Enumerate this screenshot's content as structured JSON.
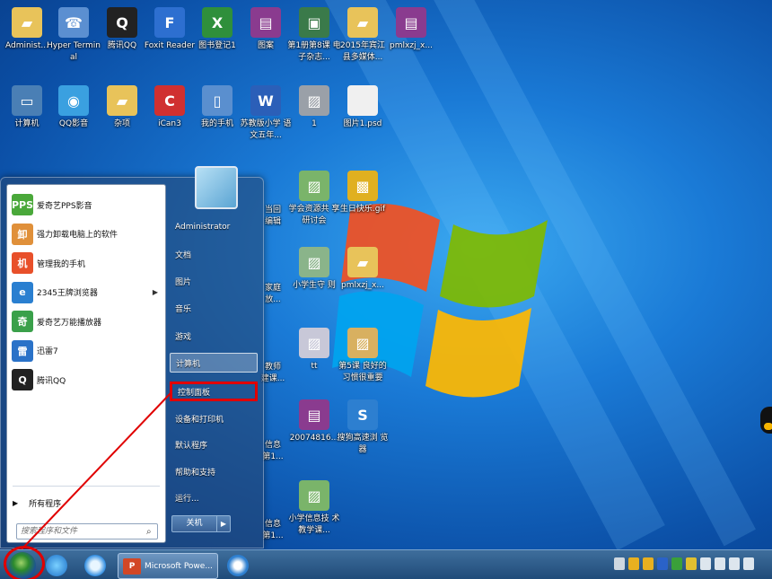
{
  "desktop": {
    "icons": [
      {
        "label": "Administ...",
        "glyph": "folder-user-icon",
        "color": "#e8c35a"
      },
      {
        "label": "Hyper Terminal",
        "glyph": "phone-network-icon",
        "color": "#5b8fd1"
      },
      {
        "label": "腾讯QQ",
        "glyph": "qq-penguin-icon",
        "color": "#222222"
      },
      {
        "label": "Foxit Reader",
        "glyph": "foxit-icon",
        "color": "#2d6fd0"
      },
      {
        "label": "图书登记1",
        "glyph": "excel-doc-icon",
        "color": "#2f8f3b"
      },
      {
        "label": "图案",
        "glyph": "winrar-icon",
        "color": "#8a3b8f"
      },
      {
        "label": "第1册第8课 电子杂志...",
        "glyph": "image-app-icon",
        "color": "#3a7a4a"
      },
      {
        "label": "2015年宾江 县多媒体...",
        "glyph": "folder-icon",
        "color": "#e8c35a"
      },
      {
        "label": "pmlxzj_x...",
        "glyph": "winrar-icon",
        "color": "#8a3b8f"
      },
      {
        "label": "计算机",
        "glyph": "computer-icon",
        "color": "#4a7fb5"
      },
      {
        "label": "QQ影音",
        "glyph": "qq-player-icon",
        "color": "#3aa0e0"
      },
      {
        "label": "杂项",
        "glyph": "folder-icon",
        "color": "#e8c35a"
      },
      {
        "label": "iCan3",
        "glyph": "ican-icon",
        "color": "#d03030"
      },
      {
        "label": "我的手机",
        "glyph": "phone-icon",
        "color": "#5a8fcf"
      },
      {
        "label": "苏教版小学 语文五年...",
        "glyph": "word-doc-icon",
        "color": "#2b5fb8"
      },
      {
        "label": "1",
        "glyph": "image-file-icon",
        "color": "#9aa0a8"
      },
      {
        "label": "图片1.psd",
        "glyph": "blank-file-icon",
        "color": "#f0f0f0"
      },
      {
        "label": "学会资源共 享研讨会",
        "glyph": "image-file-icon",
        "color": "#7ab46a"
      },
      {
        "label": "生日快乐.gif",
        "glyph": "gif-file-icon",
        "color": "#e0b020"
      },
      {
        "label": "小学生守 则",
        "glyph": "image-file-icon",
        "color": "#8ab48a"
      },
      {
        "label": "pmlxzj_x...",
        "glyph": "folder-icon",
        "color": "#e8c35a"
      },
      {
        "label": "tt",
        "glyph": "image-file-icon",
        "color": "#c8c8d8"
      },
      {
        "label": "第5课 良好的 习惯很重要",
        "glyph": "image-file-icon",
        "color": "#d8b060"
      },
      {
        "label": "20074816...",
        "glyph": "winrar-icon",
        "color": "#8a3b8f"
      },
      {
        "label": "搜狗高速浏 览器",
        "glyph": "sogou-browser-icon",
        "color": "#2d7fd0"
      },
      {
        "label": "小学信息技 术教学课...",
        "glyph": "image-file-icon",
        "color": "#7ab46a"
      }
    ],
    "partial_labels": [
      "当回 编辑",
      "家庭 放...",
      "教师 建课...",
      "信息 第1...",
      "信息 第1..."
    ]
  },
  "start_menu": {
    "programs": [
      {
        "label": "爱奇艺PPS影音",
        "icon": "pps-icon",
        "color": "#4aa83a",
        "mark": "PPS"
      },
      {
        "label": "强力卸载电脑上的软件",
        "icon": "uninstall-icon",
        "color": "#e0903a",
        "mark": "卸"
      },
      {
        "label": "管理我的手机",
        "icon": "phone-manager-icon",
        "color": "#e8502a",
        "mark": "机"
      },
      {
        "label": "2345王牌浏览器",
        "icon": "ie-browser-icon",
        "color": "#2a7fd0",
        "mark": "e",
        "has_arrow": true
      },
      {
        "label": "爱奇艺万能播放器",
        "icon": "iqiyi-player-icon",
        "color": "#3aa04a",
        "mark": "奇"
      },
      {
        "label": "迅雷7",
        "icon": "thunder-icon",
        "color": "#2a72c8",
        "mark": "雷"
      },
      {
        "label": "腾讯QQ",
        "icon": "qq-penguin-icon",
        "color": "#222222",
        "mark": "Q"
      }
    ],
    "all_programs": "所有程序",
    "search_placeholder": "搜索程序和文件",
    "right_items": [
      {
        "label": "Administrator",
        "name": "user-administrator"
      },
      {
        "label": "文档",
        "name": "documents"
      },
      {
        "label": "图片",
        "name": "pictures"
      },
      {
        "label": "音乐",
        "name": "music"
      },
      {
        "label": "游戏",
        "name": "games"
      },
      {
        "label": "计算机",
        "name": "computer"
      },
      {
        "label": "控制面板",
        "name": "control-panel"
      },
      {
        "label": "设备和打印机",
        "name": "devices-printers"
      },
      {
        "label": "默认程序",
        "name": "default-programs"
      },
      {
        "label": "帮助和支持",
        "name": "help-support"
      },
      {
        "label": "运行...",
        "name": "run"
      }
    ],
    "shutdown_label": "关机"
  },
  "taskbar": {
    "ppt_title": "Microsoft Powe...",
    "pinned": [
      "ie-icon",
      "360-browser-icon",
      "powerpoint-icon",
      "sogou-browser-icon"
    ]
  },
  "colors": {
    "annotation_red": "#e00000",
    "desktop_blue": "#1a7ad6"
  }
}
